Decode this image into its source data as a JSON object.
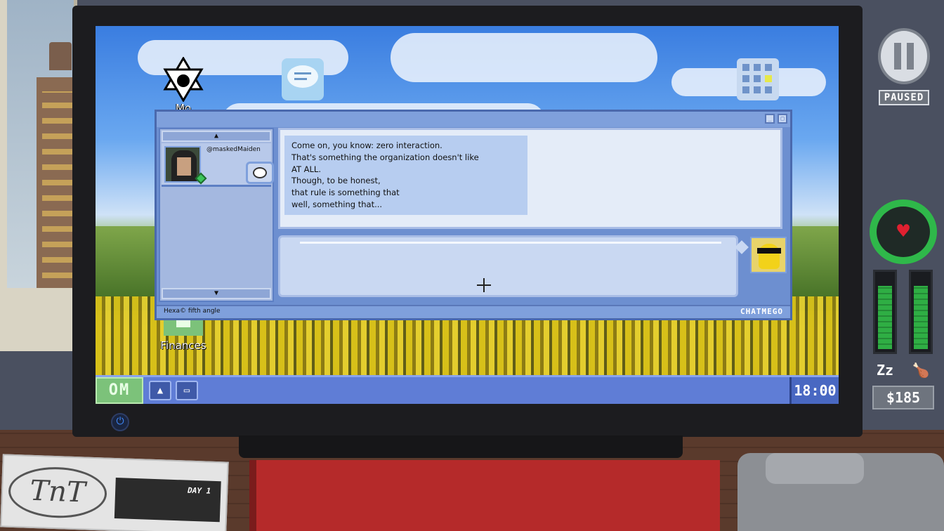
{
  "desktop": {
    "icons": [
      {
        "label": "Mo",
        "icon": "hexa-logo-icon"
      },
      {
        "label": "",
        "icon": "chat-icon"
      },
      {
        "label": "",
        "icon": "calendar-grid-icon"
      },
      {
        "label": "Finances",
        "icon": "finances-icon"
      }
    ]
  },
  "taskbar": {
    "start_label": "OM",
    "clock": "18:00",
    "items": [
      "hexa-app-icon",
      "chat-app-icon"
    ]
  },
  "chat": {
    "contact_name": "@maskedMaiden",
    "messages": [
      "Come on, you know: zero interaction.",
      "That's something the organization doesn't like",
      "AT ALL.",
      "Though, to be honest,",
      "that rule is something that",
      "well, something that..."
    ],
    "footer_left": "Hexa© fifth angle",
    "footer_right": "CHATMEGO"
  },
  "hud": {
    "paused_label": "PAUSED",
    "money": "$185",
    "health_icon": "heart-icon",
    "sleep_level": 0.85,
    "hunger_level": 0.85,
    "sleep_icon": "zz",
    "hunger_icon": "food-icon"
  },
  "desk": {
    "newspaper_day": "DAY 1",
    "newspaper_logo": "TnT"
  },
  "colors": {
    "taskbar": "#5f7dd6",
    "start": "#7cc27a",
    "window": "#6d8fd0",
    "health_ring": "#2fb84a"
  }
}
